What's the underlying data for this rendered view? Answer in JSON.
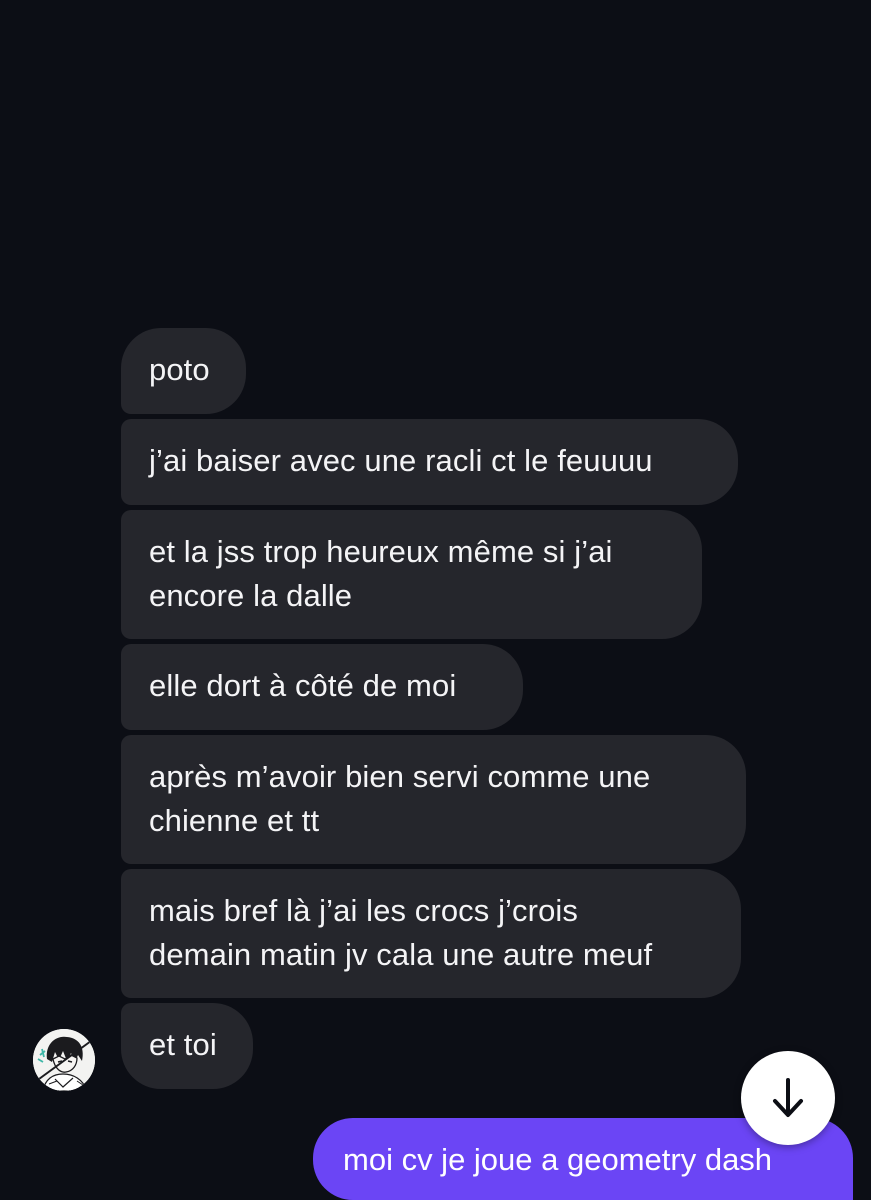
{
  "conversation": {
    "received": [
      {
        "text": "poto"
      },
      {
        "text": "j’ai baiser avec une racli ct le feuuuu"
      },
      {
        "text": "et la jss trop heureux même si j’ai\nencore la dalle"
      },
      {
        "text": "elle dort à côté de moi"
      },
      {
        "text": "après m’avoir bien servi comme une\nchienne et tt"
      },
      {
        "text": "mais bref là j’ai les crocs j’crois\ndemain matin jv cala une autre meuf"
      },
      {
        "text": "et toi"
      }
    ],
    "sent": [
      {
        "text": "moi cv je joue a geometry dash"
      }
    ]
  },
  "icons": {
    "avatar": "contact-avatar-manga-drawing",
    "scroll": "arrow-down-icon"
  },
  "colors": {
    "background": "#0c0e15",
    "received_bubble": "#25262c",
    "sent_bubble": "#6b45f5"
  }
}
